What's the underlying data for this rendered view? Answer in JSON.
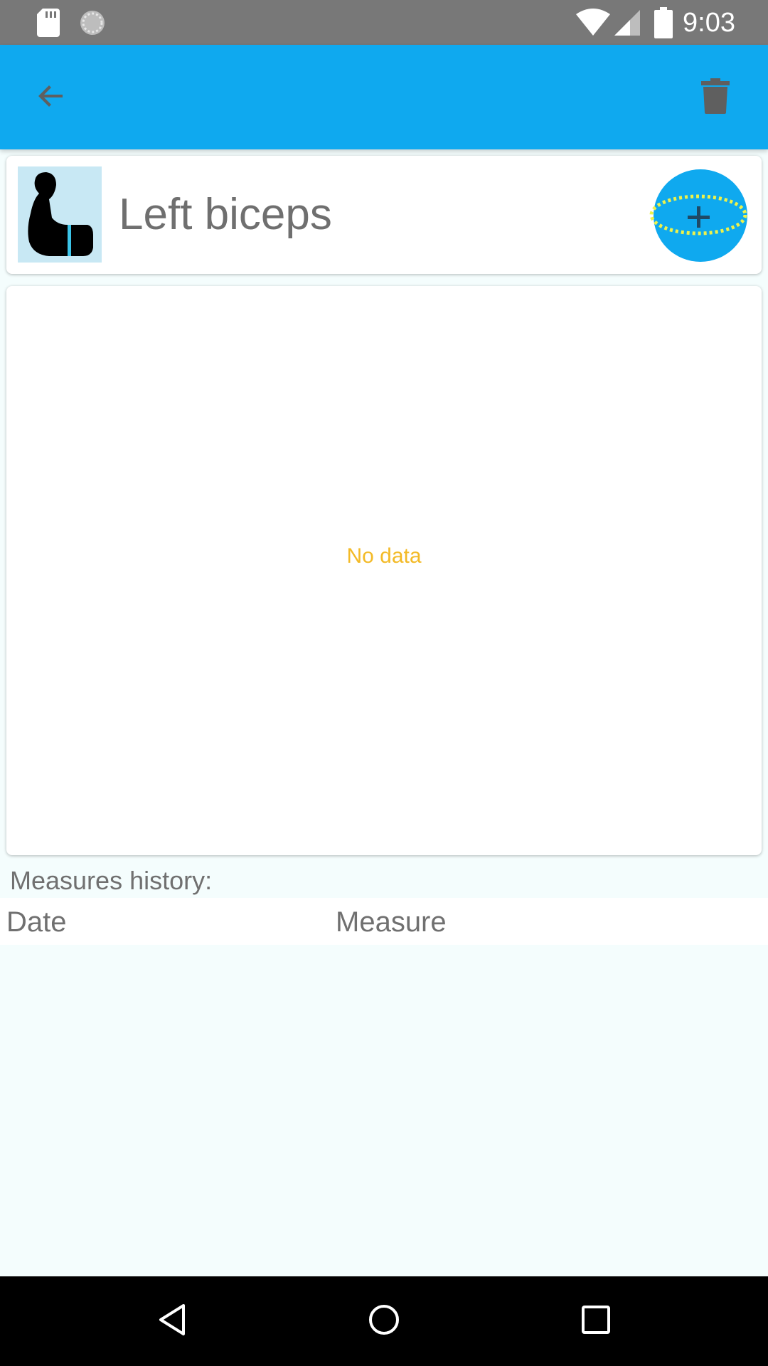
{
  "status_bar": {
    "time": "9:03",
    "icons": [
      "sd-card-icon",
      "sync-icon",
      "wifi-icon",
      "cell-signal-icon",
      "battery-icon"
    ]
  },
  "app_bar": {
    "background_color": "#0fa9ef",
    "back_icon": "arrow-back-icon",
    "delete_icon": "trash-icon"
  },
  "body_part": {
    "name": "Left biceps",
    "thumbnail_icon": "biceps-icon",
    "add_measure_icon": "add-measure-icon"
  },
  "chart": {
    "empty_text": "No data",
    "empty_text_color": "#f3ba27"
  },
  "history": {
    "label": "Measures history:",
    "columns": [
      "Date",
      "Measure"
    ],
    "rows": []
  },
  "nav_bar": {
    "buttons": [
      "nav-back-icon",
      "nav-home-icon",
      "nav-recents-icon"
    ]
  }
}
